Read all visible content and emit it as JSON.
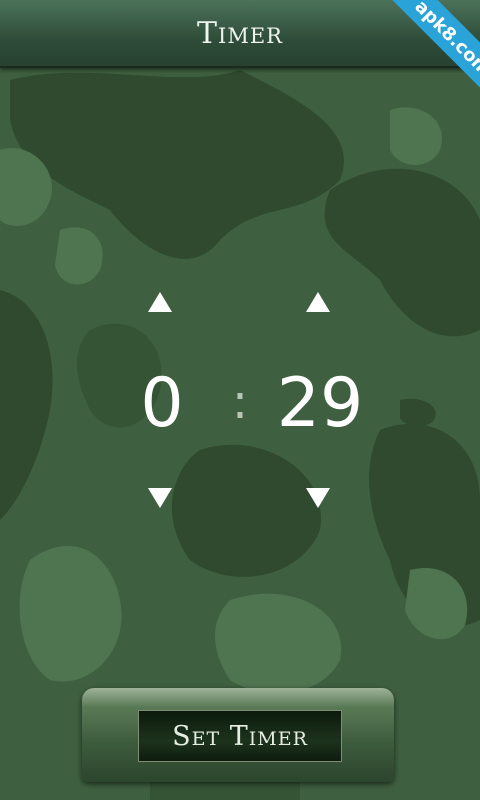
{
  "header": {
    "title": "Timer"
  },
  "watermark": {
    "text": "apk8.com",
    "color": "#2aa3d8"
  },
  "timer": {
    "minutes": "0",
    "separator": ":",
    "seconds": "29"
  },
  "actions": {
    "set_timer_label": "Set Timer"
  },
  "icons": {
    "increment": "triangle-up-icon",
    "decrement": "triangle-down-icon"
  },
  "colors": {
    "background": "#3f6040",
    "camo_dark": "#2f4a2f",
    "camo_light": "#4f7450",
    "text": "#ffffff"
  }
}
